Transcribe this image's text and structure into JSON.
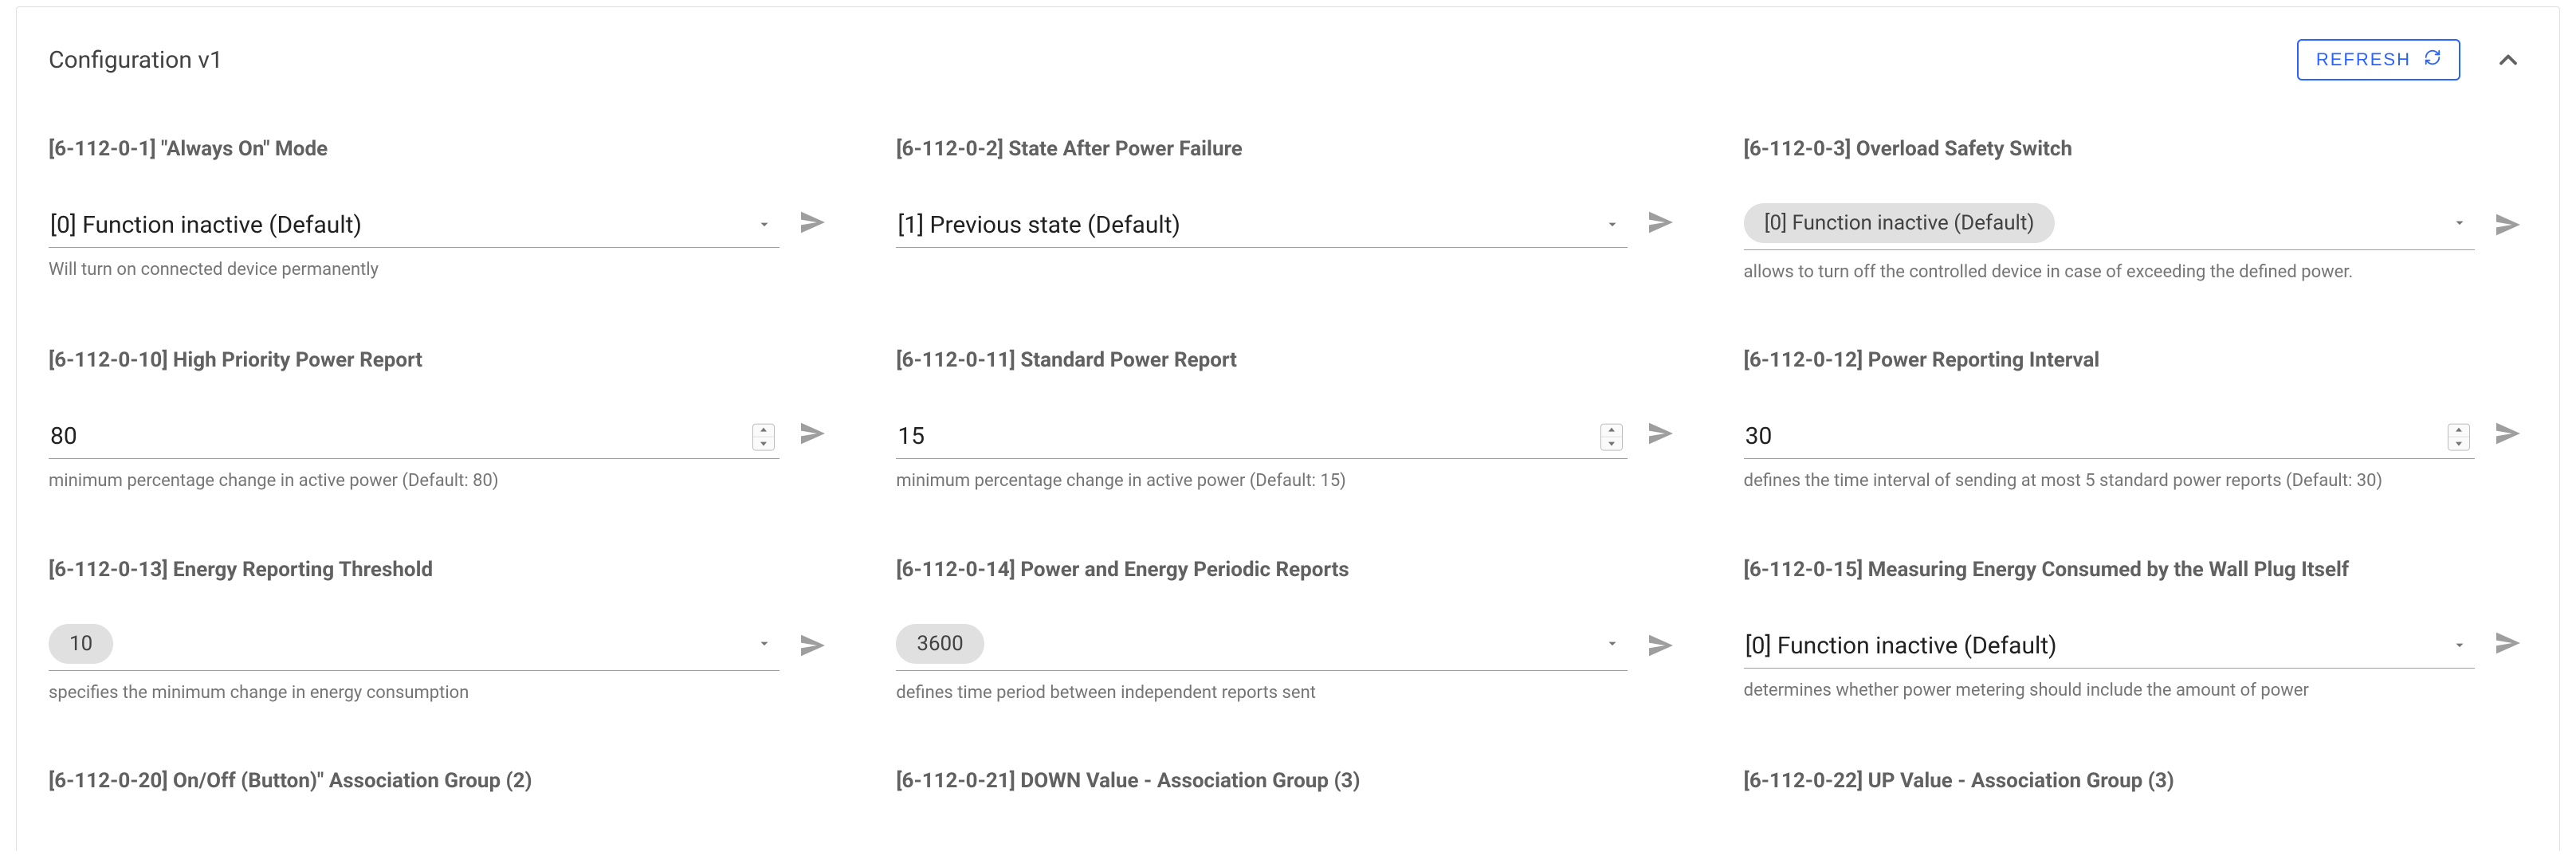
{
  "header": {
    "title": "Configuration v1",
    "refresh_label": "REFRESH"
  },
  "params": [
    {
      "id": "always-on-mode",
      "label": "[6-112-0-1] \"Always On\" Mode",
      "type": "select",
      "value": "[0] Function inactive (Default)",
      "chip": false,
      "helper": "Will turn on connected device permanently"
    },
    {
      "id": "state-after-power-failure",
      "label": "[6-112-0-2] State After Power Failure",
      "type": "select",
      "value": "[1] Previous state (Default)",
      "chip": false,
      "helper": ""
    },
    {
      "id": "overload-safety-switch",
      "label": "[6-112-0-3] Overload Safety Switch",
      "type": "select",
      "value": "[0] Function inactive (Default)",
      "chip": true,
      "helper": "allows to turn off the controlled device in case of exceeding the defined power."
    },
    {
      "id": "high-priority-power-report",
      "label": "[6-112-0-10] High Priority Power Report",
      "type": "number",
      "value": "80",
      "chip": false,
      "helper": "minimum percentage change in active power (Default: 80)"
    },
    {
      "id": "standard-power-report",
      "label": "[6-112-0-11] Standard Power Report",
      "type": "number",
      "value": "15",
      "chip": false,
      "helper": "minimum percentage change in active power (Default: 15)"
    },
    {
      "id": "power-reporting-interval",
      "label": "[6-112-0-12] Power Reporting Interval",
      "type": "number",
      "value": "30",
      "chip": false,
      "helper": "defines the time interval of sending at most 5 standard power reports (Default: 30)"
    },
    {
      "id": "energy-reporting-threshold",
      "label": "[6-112-0-13] Energy Reporting Threshold",
      "type": "select",
      "value": "10",
      "chip": true,
      "helper": "specifies the minimum change in energy consumption"
    },
    {
      "id": "power-energy-periodic-reports",
      "label": "[6-112-0-14] Power and Energy Periodic Reports",
      "type": "select",
      "value": "3600",
      "chip": true,
      "helper": "defines time period between independent reports sent"
    },
    {
      "id": "measuring-energy-self",
      "label": "[6-112-0-15] Measuring Energy Consumed by the Wall Plug Itself",
      "type": "select",
      "value": "[0] Function inactive (Default)",
      "chip": false,
      "helper": "determines whether power metering should include the amount of power"
    },
    {
      "id": "onoff-button-assoc-group-2",
      "label": "[6-112-0-20] On/Off (Button)\" Association Group (2)",
      "type": "label-only",
      "value": "",
      "chip": false,
      "helper": ""
    },
    {
      "id": "down-value-assoc-group-3",
      "label": "[6-112-0-21] DOWN Value - Association Group (3)",
      "type": "label-only",
      "value": "",
      "chip": false,
      "helper": ""
    },
    {
      "id": "up-value-assoc-group-3",
      "label": "[6-112-0-22] UP Value - Association Group (3)",
      "type": "label-only",
      "value": "",
      "chip": false,
      "helper": ""
    }
  ]
}
